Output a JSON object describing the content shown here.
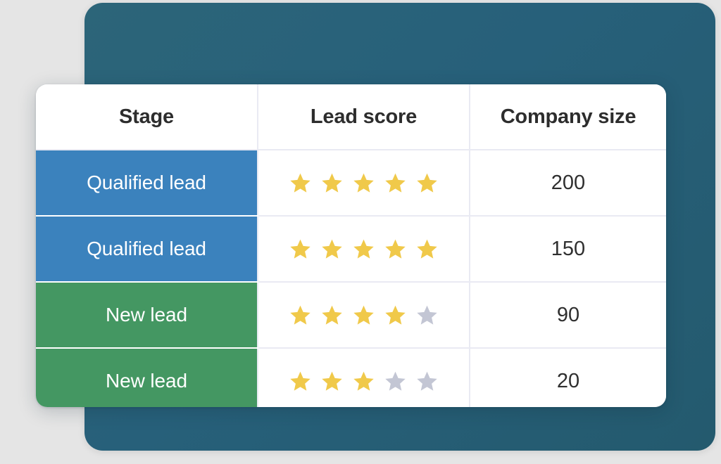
{
  "colors": {
    "page_background": "#e5e5e5",
    "panel_teal": "#27607a",
    "card_white": "#ffffff",
    "stage_qualified_blue": "#3b82bd",
    "stage_new_green": "#449762",
    "star_filled_gold": "#f0c94a",
    "star_empty_grey": "#c3c6d4",
    "grid_line": "#e9eaf3",
    "header_text": "#2d2d2d",
    "value_text": "#2f2f2f"
  },
  "table": {
    "columns": [
      {
        "key": "stage",
        "label": "Stage"
      },
      {
        "key": "lead_score",
        "label": "Lead score"
      },
      {
        "key": "company_size",
        "label": "Company size"
      }
    ],
    "max_stars": 5,
    "rows": [
      {
        "stage": "Qualified lead",
        "stage_type": "qualified",
        "lead_score": 5,
        "company_size": "200"
      },
      {
        "stage": "Qualified lead",
        "stage_type": "qualified",
        "lead_score": 5,
        "company_size": "150"
      },
      {
        "stage": "New lead",
        "stage_type": "new",
        "lead_score": 4,
        "company_size": "90"
      },
      {
        "stage": "New lead",
        "stage_type": "new",
        "lead_score": 3,
        "company_size": "20"
      }
    ]
  },
  "icons": {
    "star_filled": "star-filled-icon",
    "star_empty": "star-empty-icon"
  }
}
